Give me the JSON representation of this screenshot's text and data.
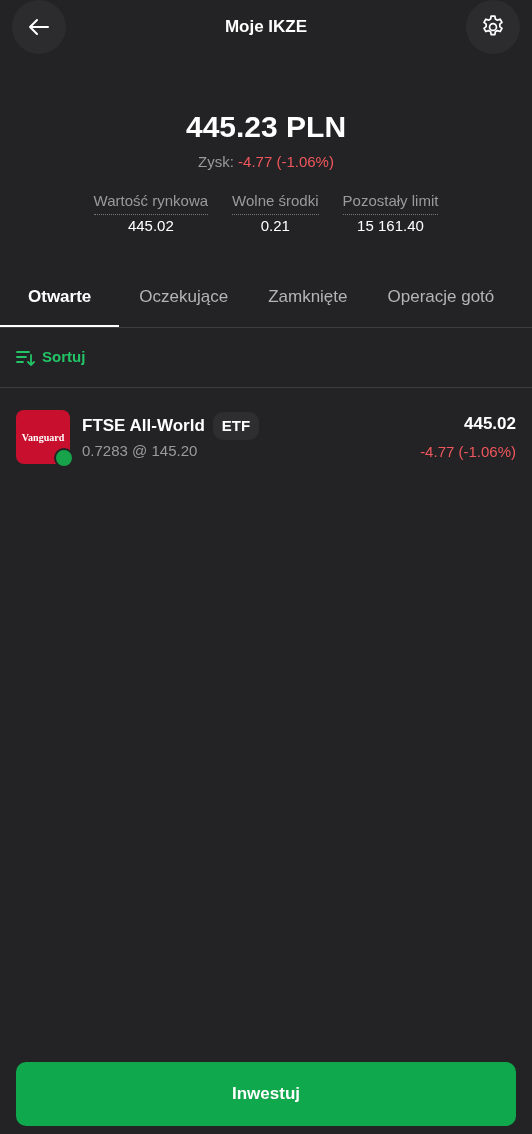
{
  "header": {
    "title": "Moje IKZE"
  },
  "summary": {
    "total": "445.23 PLN",
    "profit_label": "Zysk:",
    "profit_value": "-4.77 (-1.06%)",
    "stats": [
      {
        "label": "Wartość rynkowa",
        "value": "445.02"
      },
      {
        "label": "Wolne środki",
        "value": "0.21"
      },
      {
        "label": "Pozostały limit",
        "value": "15 161.40"
      }
    ]
  },
  "tabs": [
    {
      "label": "Otwarte",
      "selected": true
    },
    {
      "label": "Oczekujące",
      "selected": false
    },
    {
      "label": "Zamknięte",
      "selected": false
    },
    {
      "label": "Operacje gotó",
      "selected": false
    }
  ],
  "sort_button": "Sortuj",
  "holdings": [
    {
      "logo_text": "Vanguard",
      "name": "FTSE All-World",
      "tag": "ETF",
      "detail": "0.7283 @ 145.20",
      "value": "445.02",
      "change": "-4.77 (-1.06%)",
      "color": "#16a34a"
    }
  ],
  "invest_button": "Inwestuj"
}
